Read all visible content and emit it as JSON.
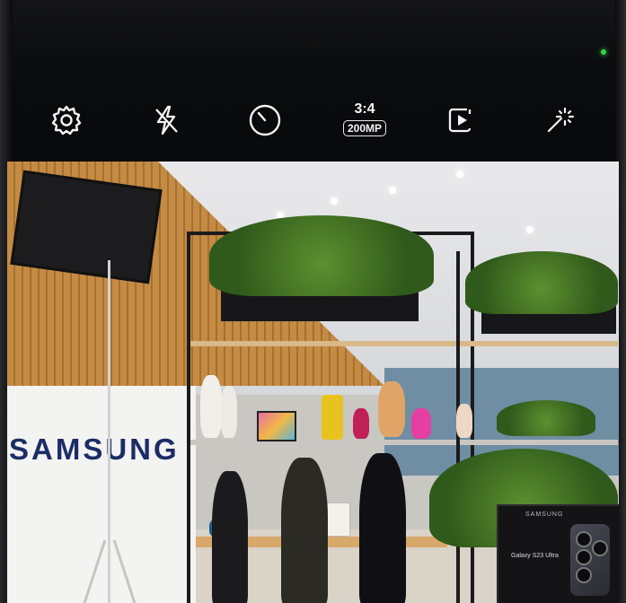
{
  "camera": {
    "toolbar": {
      "settings_icon": "gear-icon",
      "flash_icon": "flash-off-icon",
      "timer_icon": "timer-icon",
      "aspect_ratio": "3:4",
      "resolution": "200MP",
      "motion_photo_icon": "motion-photo-icon",
      "effects_icon": "magic-effects-icon"
    },
    "viewfinder": {
      "scene_text_wall": "SAMSUNG",
      "scene_text_tv_brand": "SAMSUNG",
      "scene_text_tv_model": "Galaxy S23 Ultra"
    }
  },
  "colors": {
    "ui_foreground": "#f4f4f4",
    "status_led": "#35d14a"
  }
}
